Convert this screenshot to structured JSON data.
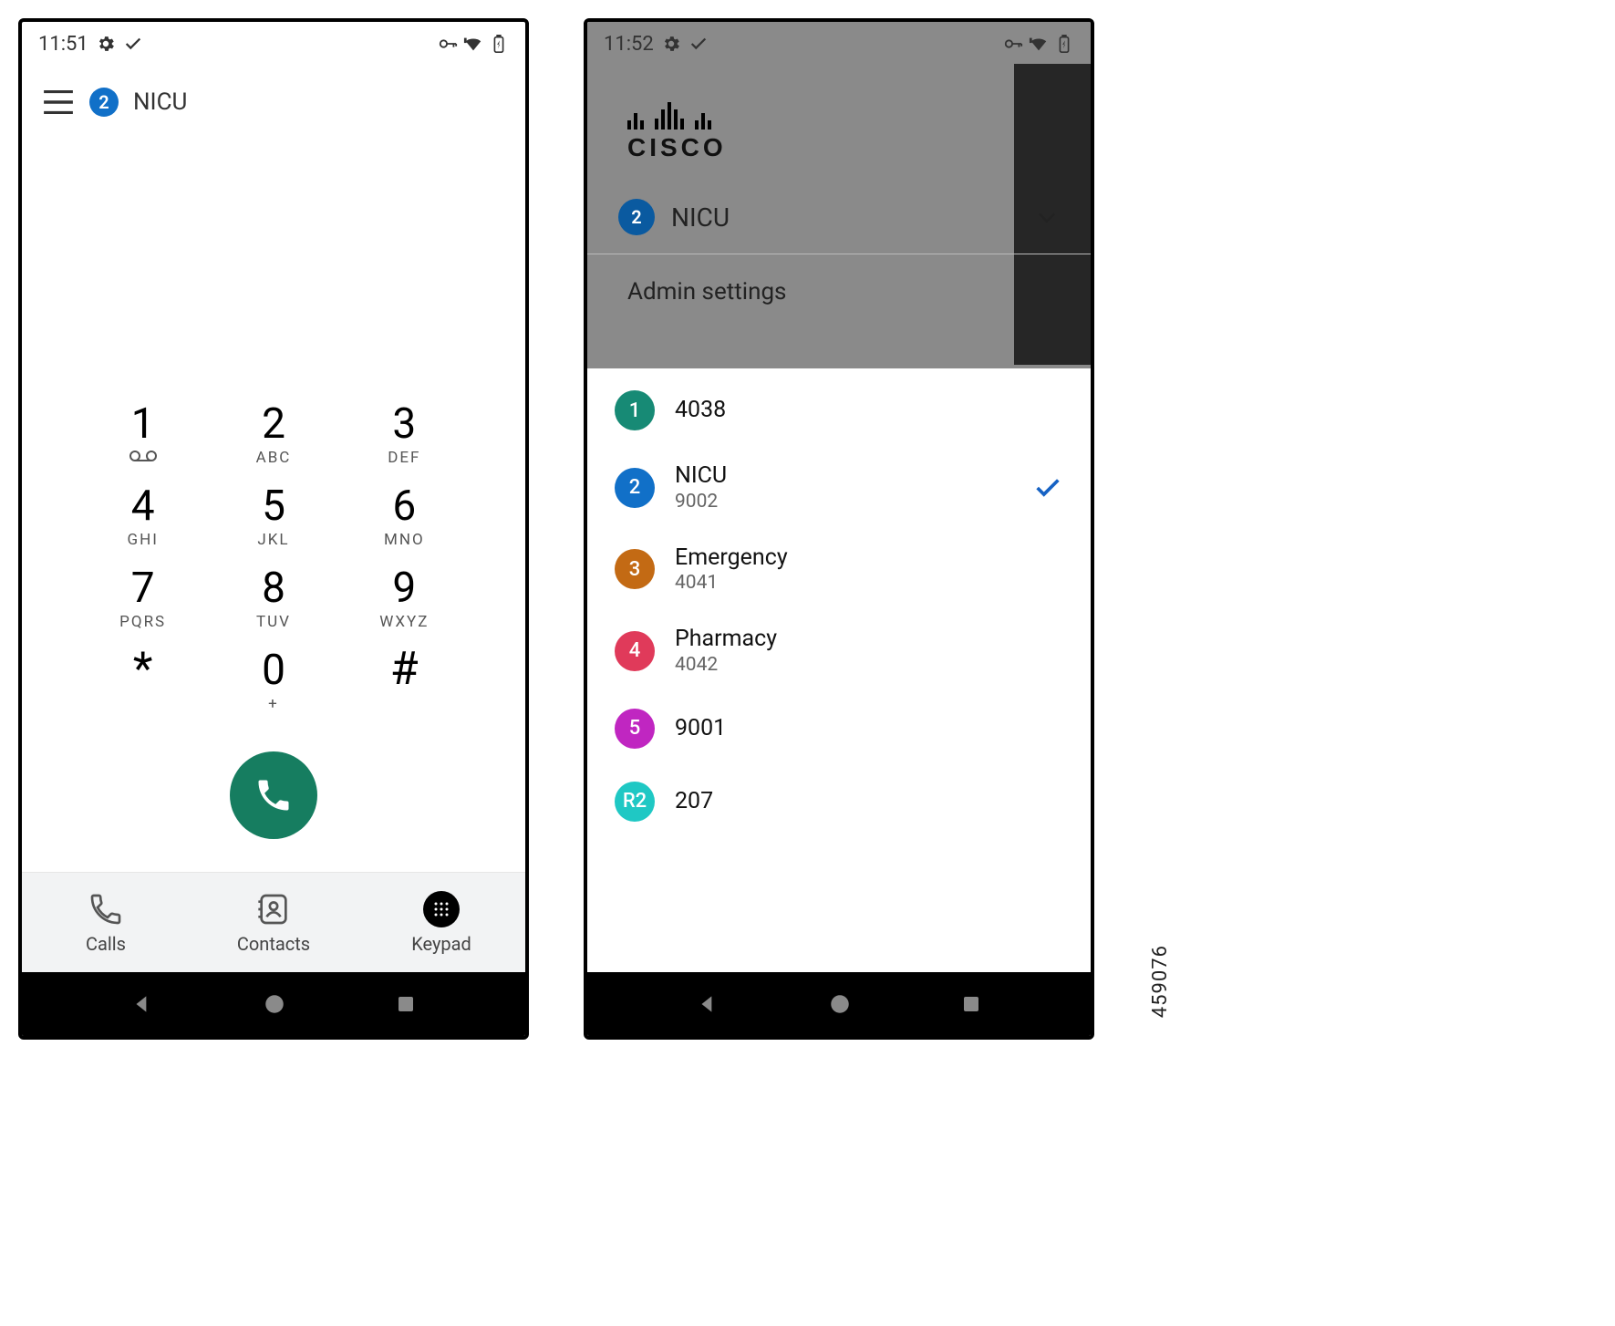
{
  "figure_id": "459076",
  "colors": {
    "badge_blue": "#1170c8",
    "call_green": "#167d60",
    "teal": "#178a75",
    "brown": "#c36a14",
    "red": "#e03a5a",
    "magenta": "#c026c1",
    "cyan": "#1fc8c4"
  },
  "screen1": {
    "status": {
      "time": "11:51"
    },
    "header": {
      "badge_number": "2",
      "line_name": "NICU"
    },
    "keypad": [
      {
        "digit": "1",
        "sub": ""
      },
      {
        "digit": "2",
        "sub": "ABC"
      },
      {
        "digit": "3",
        "sub": "DEF"
      },
      {
        "digit": "4",
        "sub": "GHI"
      },
      {
        "digit": "5",
        "sub": "JKL"
      },
      {
        "digit": "6",
        "sub": "MNO"
      },
      {
        "digit": "7",
        "sub": "PQRS"
      },
      {
        "digit": "8",
        "sub": "TUV"
      },
      {
        "digit": "9",
        "sub": "WXYZ"
      },
      {
        "digit": "*",
        "sub": ""
      },
      {
        "digit": "0",
        "sub": "+"
      },
      {
        "digit": "#",
        "sub": ""
      }
    ],
    "tabs": {
      "calls": "Calls",
      "contacts": "Contacts",
      "keypad": "Keypad"
    }
  },
  "screen2": {
    "status": {
      "time": "11:52"
    },
    "brand": "CISCO",
    "drawer": {
      "badge_number": "2",
      "line_name": "NICU",
      "admin": "Admin settings"
    },
    "lines": [
      {
        "index": "1",
        "name": "4038",
        "number": "",
        "color": "#178a75",
        "selected": false
      },
      {
        "index": "2",
        "name": "NICU",
        "number": "9002",
        "color": "#1170c8",
        "selected": true
      },
      {
        "index": "3",
        "name": "Emergency",
        "number": "4041",
        "color": "#c36a14",
        "selected": false
      },
      {
        "index": "4",
        "name": "Pharmacy",
        "number": "4042",
        "color": "#e03a5a",
        "selected": false
      },
      {
        "index": "5",
        "name": "9001",
        "number": "",
        "color": "#c026c1",
        "selected": false
      },
      {
        "index": "R2",
        "name": "207",
        "number": "",
        "color": "#1fc8c4",
        "selected": false
      }
    ]
  }
}
